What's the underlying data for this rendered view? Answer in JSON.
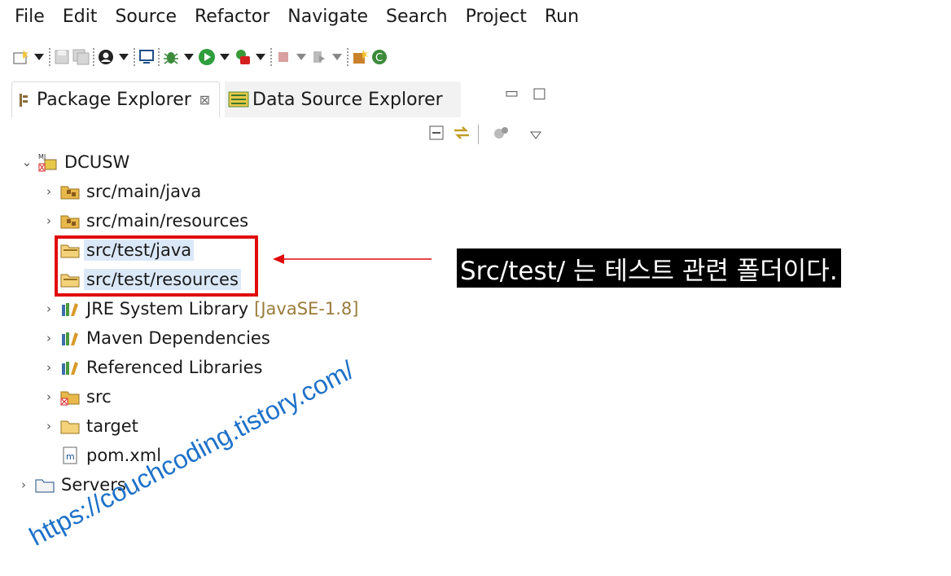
{
  "menu": [
    "File",
    "Edit",
    "Source",
    "Refactor",
    "Navigate",
    "Search",
    "Project",
    "Run"
  ],
  "toolbar": {
    "icons": [
      "new-icon",
      "save-icon",
      "save-all-icon",
      "profile-icon",
      "terminal-icon",
      "debug-icon",
      "run-icon",
      "external-tools-icon",
      "stop-icon",
      "next-annotation-icon",
      "open-type-icon",
      "refresh-icon"
    ]
  },
  "tabs": {
    "active": "Package Explorer",
    "close_glyph": "⊠",
    "inactive": "Data Source Explorer",
    "minimize": "▭",
    "maximize": "□"
  },
  "tree": {
    "project": "DCUSW",
    "items": [
      {
        "label": "src/main/java",
        "expand": "›",
        "icon": "package-folder-icon"
      },
      {
        "label": "src/main/resources",
        "expand": "›",
        "icon": "package-folder-icon"
      },
      {
        "label": "src/test/java",
        "expand": "",
        "icon": "package-folder-icon",
        "selected": true
      },
      {
        "label": "src/test/resources",
        "expand": "",
        "icon": "package-folder-icon",
        "selected": true
      },
      {
        "label": "JRE System Library",
        "extra": "[JavaSE-1.8]",
        "expand": "›",
        "icon": "library-icon"
      },
      {
        "label": "Maven Dependencies",
        "expand": "›",
        "icon": "library-icon"
      },
      {
        "label": "Referenced Libraries",
        "expand": "›",
        "icon": "library-icon"
      },
      {
        "label": "src",
        "expand": "›",
        "icon": "error-folder-icon"
      },
      {
        "label": "target",
        "expand": "›",
        "icon": "folder-icon"
      },
      {
        "label": "pom.xml",
        "expand": "",
        "icon": "maven-file-icon"
      }
    ],
    "servers": "Servers"
  },
  "annotation": {
    "text": "Src/test/ 는 테스트 관련 폴더이다.",
    "color": "#e00b0b"
  },
  "watermark": "https://couchcoding.tistory.com/"
}
